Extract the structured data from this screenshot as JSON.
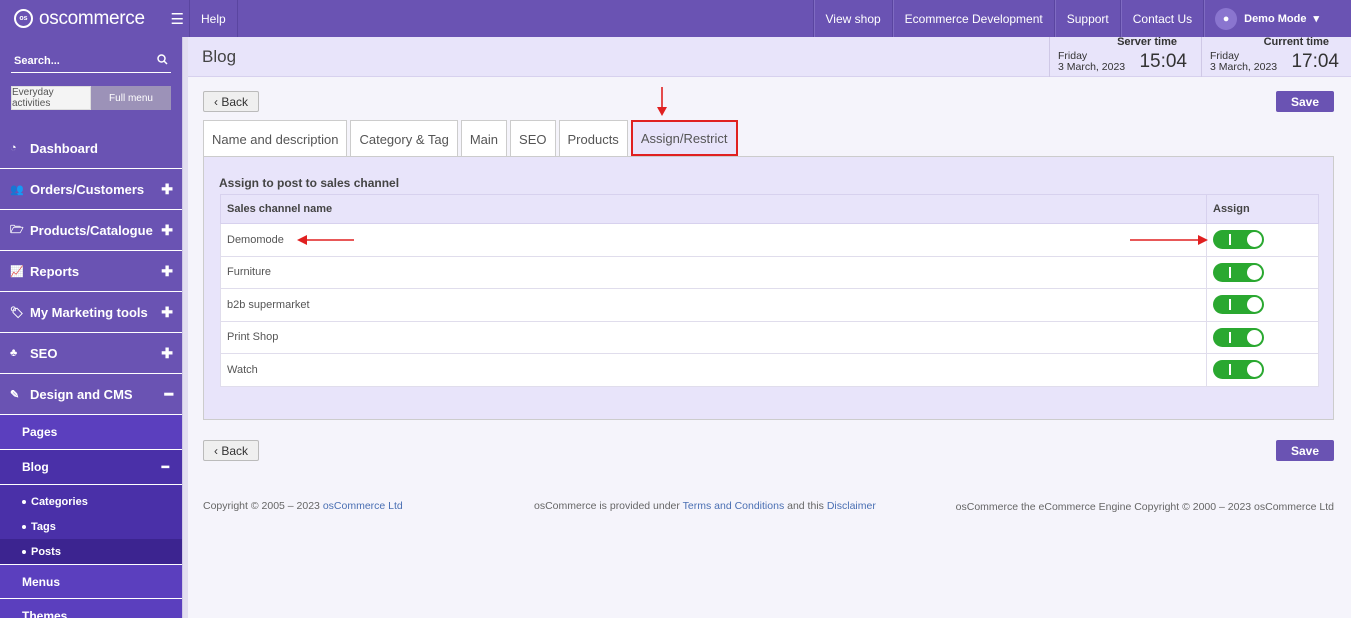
{
  "topbar": {
    "brand": "oscommerce",
    "help": "Help",
    "links": [
      "View shop",
      "Ecommerce Development",
      "Support",
      "Contact Us"
    ],
    "user": "Demo Mode"
  },
  "sidebar": {
    "search_label": "Search...",
    "switch": {
      "everyday": "Everyday activities",
      "full": "Full menu"
    },
    "items": [
      {
        "label": "Dashboard"
      },
      {
        "label": "Orders/Customers"
      },
      {
        "label": "Products/Catalogue"
      },
      {
        "label": "Reports"
      },
      {
        "label": "My Marketing tools"
      },
      {
        "label": "SEO"
      },
      {
        "label": "Design and CMS"
      }
    ],
    "sub": {
      "pages": "Pages",
      "blog": "Blog",
      "blog_children": [
        "Categories",
        "Tags",
        "Posts"
      ],
      "menus": "Menus",
      "themes": "Themes"
    }
  },
  "header": {
    "title": "Blog",
    "server_time": {
      "label": "Server time",
      "day": "Friday",
      "date": "3 March, 2023",
      "time": "15:04"
    },
    "current_time": {
      "label": "Current time",
      "day": "Friday",
      "date": "3 March, 2023",
      "time": "17:04"
    }
  },
  "buttons": {
    "back": "‹ Back",
    "save": "Save"
  },
  "tabs": [
    "Name and description",
    "Category & Tag",
    "Main",
    "SEO",
    "Products",
    "Assign/Restrict"
  ],
  "panel": {
    "title": "Assign to post to sales channel",
    "columns": [
      "Sales channel name",
      "Assign"
    ],
    "rows": [
      "Demomode",
      "Furniture",
      "b2b supermarket",
      "Print Shop",
      "Watch"
    ]
  },
  "footer": {
    "copyright_prefix": "Copyright © 2005 – 2023 ",
    "company_link": "osCommerce Ltd",
    "provided_prefix": "osCommerce is provided under ",
    "terms_link": "Terms and Conditions",
    "and_this": " and this ",
    "disclaimer_link": "Disclaimer",
    "engine": "osCommerce the eCommerce Engine Copyright © 2000 – 2023 osCommerce Ltd"
  },
  "colors": {
    "brand": "#6a53b3",
    "toggle_on": "#2aa830",
    "annotation": "#e02020"
  }
}
